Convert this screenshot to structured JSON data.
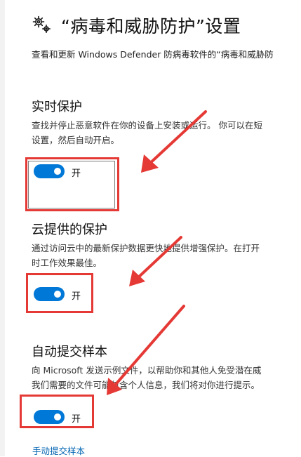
{
  "header": {
    "title": "“病毒和威胁防护”设置",
    "subtitle": "查看和更新 Windows Defender 防病毒软件的“病毒和威胁防"
  },
  "sections": [
    {
      "title": "实时保护",
      "desc_lines": [
        "查找并停止恶意软件在你的设备上安装或运行。 你可以在短",
        "设置，然后自动开启。"
      ],
      "toggle": {
        "on": true,
        "label": "开"
      }
    },
    {
      "title": "云提供的保护",
      "desc_lines": [
        "通过访问云中的最新保护数据更快地提供增强保护。在打开",
        "时工作效果最佳。"
      ],
      "toggle": {
        "on": true,
        "label": "开"
      }
    },
    {
      "title": "自动提交样本",
      "desc_lines": [
        "向 Microsoft 发送示例文件，以帮助你和其他人免受潜在威",
        "我们需要的文件可能包含个人信息，我们将对你进行提示。"
      ],
      "toggle": {
        "on": true,
        "label": "开"
      }
    }
  ],
  "link": {
    "label": "手动提交样本"
  },
  "colors": {
    "accent": "#0078d7",
    "annotation": "#e53935",
    "link": "#0063b1"
  },
  "icons": {
    "header": "gear-icon",
    "annotation": "arrow-icon"
  }
}
